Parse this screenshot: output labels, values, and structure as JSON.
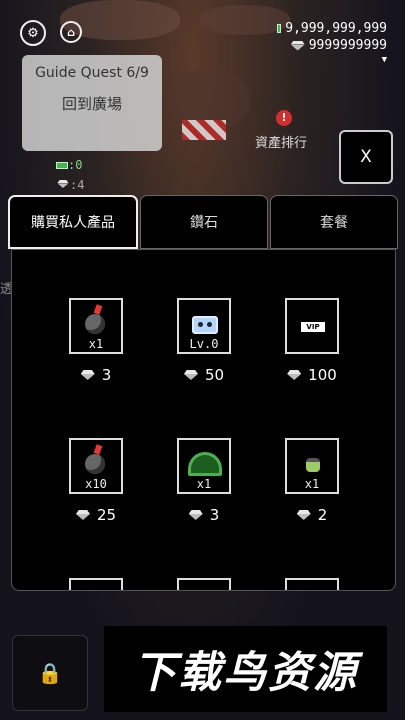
{
  "hud": {
    "settings_icon": "gear-icon",
    "home_icon": "home-icon",
    "cash": "9,999,999,999",
    "gems": "9999999999",
    "dropdown_icon": "chevron-down-icon"
  },
  "guide": {
    "title": "Guide Quest  6/9",
    "action": "回到廣場"
  },
  "stats": {
    "cash_small": ":0",
    "gems_small": ":4"
  },
  "rank_label": "資產排行",
  "alert_mark": "!",
  "close_label": "X",
  "side_label": "透",
  "tabs": [
    {
      "label": "購買私人產品",
      "active": true
    },
    {
      "label": "鑽石",
      "active": false
    },
    {
      "label": "套餐",
      "active": false
    }
  ],
  "items": [
    {
      "icon": "bomb-icon",
      "qty": "x1",
      "price": "3"
    },
    {
      "icon": "robot-icon",
      "qty": "Lv.0",
      "price": "50"
    },
    {
      "icon": "vip-icon",
      "qty": "",
      "price": "100"
    },
    {
      "icon": "bomb-icon",
      "qty": "x10",
      "price": "25"
    },
    {
      "icon": "helmet-icon",
      "qty": "x1",
      "price": "3"
    },
    {
      "icon": "potion-icon",
      "qty": "x1",
      "price": "2"
    }
  ],
  "watermark": "下载鸟资源",
  "colors": {
    "accent_green": "#4caf50",
    "alert_red": "#d32f2f",
    "panel_bg": "#000000"
  }
}
